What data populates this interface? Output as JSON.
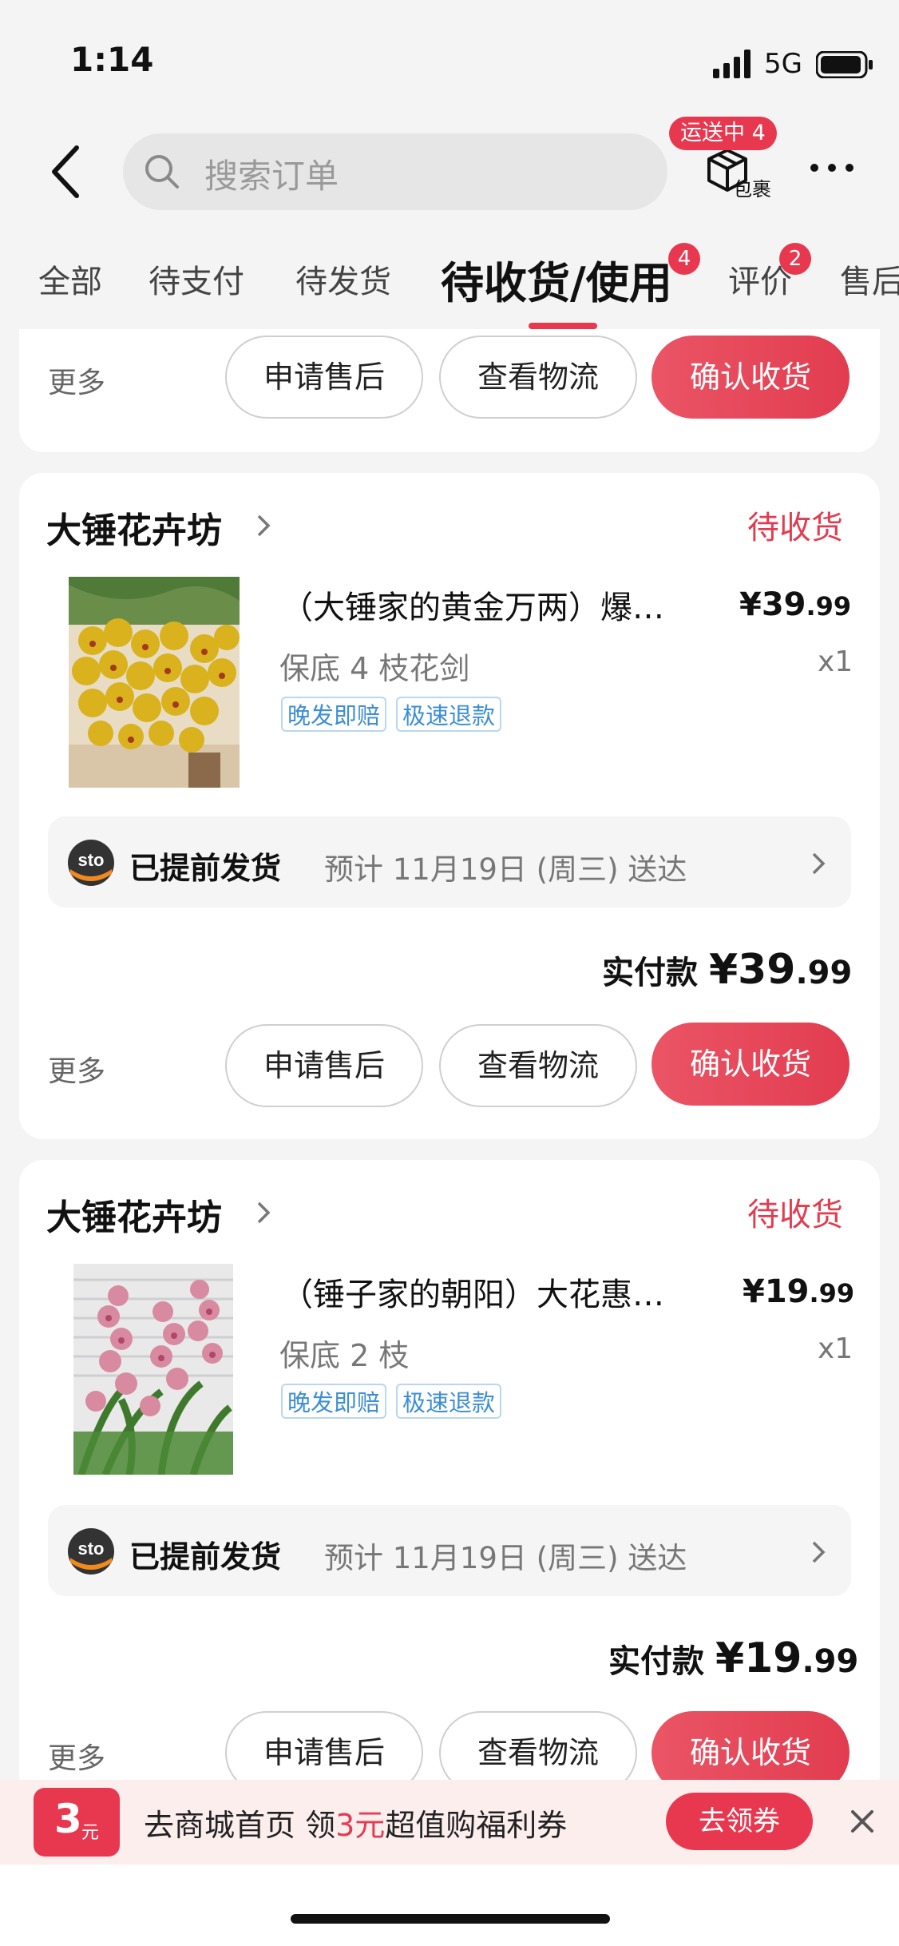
{
  "status_bar": {
    "time": "1:14",
    "network": "5G"
  },
  "header": {
    "search_placeholder": "搜索订单",
    "shipping_badge": "运送中 4",
    "package_label": "包裹"
  },
  "tabs": [
    {
      "label": "全部"
    },
    {
      "label": "待支付"
    },
    {
      "label": "待发货"
    },
    {
      "label": "待收货/使用",
      "badge": "4"
    },
    {
      "label": "评价",
      "badge": "2"
    },
    {
      "label": "售后"
    }
  ],
  "actions": {
    "more": "更多",
    "after_sale": "申请售后",
    "logistics": "查看物流",
    "confirm": "确认收货"
  },
  "orders": [
    {
      "shop": "大锤花卉坊",
      "status": "待收货",
      "title": "（大锤家的黄金万两）爆…",
      "spec": "保底 4 枝花剑",
      "price_int": "¥39",
      "price_dec": ".99",
      "qty": "x1",
      "tags": [
        "晚发即赔",
        "极速退款"
      ],
      "ship_title": "已提前发货",
      "ship_eta": "预计 11月19日 (周三) 送达",
      "paid_label": "实付款",
      "paid_int": "¥39",
      "paid_dec": ".99"
    },
    {
      "shop": "大锤花卉坊",
      "status": "待收货",
      "title": "（锤子家的朝阳）大花惠…",
      "spec": "保底 2 枝",
      "price_int": "¥19",
      "price_dec": ".99",
      "qty": "x1",
      "tags": [
        "晚发即赔",
        "极速退款"
      ],
      "ship_title": "已提前发货",
      "ship_eta": "预计 11月19日 (周三) 送达",
      "paid_label": "实付款",
      "paid_int": "¥19",
      "paid_dec": ".99"
    }
  ],
  "coupon": {
    "amount": "3",
    "unit": "元",
    "text_a": "去商城首页 领",
    "text_b": "3元",
    "text_c": "超值购福利券",
    "button": "去领券"
  },
  "colors": {
    "accent": "#e8384f",
    "tag": "#3e8ed4"
  }
}
